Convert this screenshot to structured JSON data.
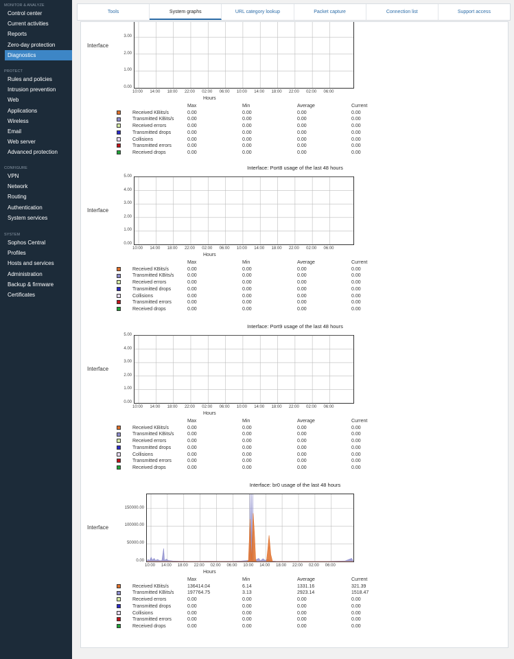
{
  "sidebar": {
    "sections": [
      {
        "title": "MONITOR & ANALYZE",
        "items": [
          {
            "label": "Control center",
            "name": "sidebar-item-control-center"
          },
          {
            "label": "Current activities",
            "name": "sidebar-item-current-activities"
          },
          {
            "label": "Reports",
            "name": "sidebar-item-reports"
          },
          {
            "label": "Zero-day protection",
            "name": "sidebar-item-zero-day-protection"
          },
          {
            "label": "Diagnostics",
            "name": "sidebar-item-diagnostics",
            "active": true
          }
        ]
      },
      {
        "title": "PROTECT",
        "items": [
          {
            "label": "Rules and policies",
            "name": "sidebar-item-rules-and-policies"
          },
          {
            "label": "Intrusion prevention",
            "name": "sidebar-item-intrusion-prevention"
          },
          {
            "label": "Web",
            "name": "sidebar-item-web"
          },
          {
            "label": "Applications",
            "name": "sidebar-item-applications"
          },
          {
            "label": "Wireless",
            "name": "sidebar-item-wireless"
          },
          {
            "label": "Email",
            "name": "sidebar-item-email"
          },
          {
            "label": "Web server",
            "name": "sidebar-item-web-server"
          },
          {
            "label": "Advanced protection",
            "name": "sidebar-item-advanced-protection"
          }
        ]
      },
      {
        "title": "CONFIGURE",
        "items": [
          {
            "label": "VPN",
            "name": "sidebar-item-vpn"
          },
          {
            "label": "Network",
            "name": "sidebar-item-network"
          },
          {
            "label": "Routing",
            "name": "sidebar-item-routing"
          },
          {
            "label": "Authentication",
            "name": "sidebar-item-authentication"
          },
          {
            "label": "System services",
            "name": "sidebar-item-system-services"
          }
        ]
      },
      {
        "title": "SYSTEM",
        "items": [
          {
            "label": "Sophos Central",
            "name": "sidebar-item-sophos-central"
          },
          {
            "label": "Profiles",
            "name": "sidebar-item-profiles"
          },
          {
            "label": "Hosts and services",
            "name": "sidebar-item-hosts-and-services"
          },
          {
            "label": "Administration",
            "name": "sidebar-item-administration"
          },
          {
            "label": "Backup & firmware",
            "name": "sidebar-item-backup-firmware"
          },
          {
            "label": "Certificates",
            "name": "sidebar-item-certificates"
          }
        ]
      }
    ]
  },
  "tabs": [
    {
      "label": "Tools",
      "name": "tab-tools"
    },
    {
      "label": "System graphs",
      "name": "tab-system-graphs",
      "active": true
    },
    {
      "label": "URL category lookup",
      "name": "tab-url-category-lookup"
    },
    {
      "label": "Packet capture",
      "name": "tab-packet-capture"
    },
    {
      "label": "Connection list",
      "name": "tab-connection-list"
    },
    {
      "label": "Support access",
      "name": "tab-support-access"
    }
  ],
  "legend_colors": {
    "received_kbits": "#e0712b",
    "transmitted_kbits": "#8f8fce",
    "received_errors": "#d6eaa6",
    "transmitted_drops": "#2b2bc8",
    "collisions": "#e9dcf2",
    "transmitted_errors": "#c0141a",
    "received_drops": "#22a33a"
  },
  "stats_headers": {
    "max": "Max",
    "min": "Min",
    "average": "Average",
    "current": "Current"
  },
  "chart_data": [
    {
      "type": "line",
      "title": "",
      "side_label": "Interface",
      "xlabel": "Hours",
      "x_ticks": [
        "10:00",
        "14:00",
        "18:00",
        "22:00",
        "02:00",
        "06:00",
        "10:00",
        "14:00",
        "18:00",
        "22:00",
        "02:00",
        "06:00"
      ],
      "y_ticks": [
        "0.00",
        "1.00",
        "2.00",
        "3.00",
        "4.00"
      ],
      "ylim": [
        0,
        5
      ],
      "series": [],
      "stats": [
        {
          "name": "Received KBits/s",
          "color_key": "received_kbits",
          "max": "0.00",
          "min": "0.00",
          "avg": "0.00",
          "cur": "0.00"
        },
        {
          "name": "Transmitted KBits/s",
          "color_key": "transmitted_kbits",
          "max": "0.00",
          "min": "0.00",
          "avg": "0.00",
          "cur": "0.00"
        },
        {
          "name": "Received errors",
          "color_key": "received_errors",
          "max": "0.00",
          "min": "0.00",
          "avg": "0.00",
          "cur": "0.00"
        },
        {
          "name": "Transmitted drops",
          "color_key": "transmitted_drops",
          "max": "0.00",
          "min": "0.00",
          "avg": "0.00",
          "cur": "0.00"
        },
        {
          "name": "Collisions",
          "color_key": "collisions",
          "max": "0.00",
          "min": "0.00",
          "avg": "0.00",
          "cur": "0.00"
        },
        {
          "name": "Transmitted errors",
          "color_key": "transmitted_errors",
          "max": "0.00",
          "min": "0.00",
          "avg": "0.00",
          "cur": "0.00"
        },
        {
          "name": "Received drops",
          "color_key": "received_drops",
          "max": "0.00",
          "min": "0.00",
          "avg": "0.00",
          "cur": "0.00"
        }
      ]
    },
    {
      "type": "line",
      "title": "Interface: Port8 usage of the last 48 hours",
      "side_label": "Interface",
      "xlabel": "Hours",
      "x_ticks": [
        "10:00",
        "14:00",
        "18:00",
        "22:00",
        "02:00",
        "06:00",
        "10:00",
        "14:00",
        "18:00",
        "22:00",
        "02:00",
        "06:00"
      ],
      "y_ticks": [
        "0.00",
        "1.00",
        "2.00",
        "3.00",
        "4.00",
        "5.00"
      ],
      "ylim": [
        0,
        5
      ],
      "series": [],
      "stats": [
        {
          "name": "Received KBits/s",
          "color_key": "received_kbits",
          "max": "0.00",
          "min": "0.00",
          "avg": "0.00",
          "cur": "0.00"
        },
        {
          "name": "Transmitted KBits/s",
          "color_key": "transmitted_kbits",
          "max": "0.00",
          "min": "0.00",
          "avg": "0.00",
          "cur": "0.00"
        },
        {
          "name": "Received errors",
          "color_key": "received_errors",
          "max": "0.00",
          "min": "0.00",
          "avg": "0.00",
          "cur": "0.00"
        },
        {
          "name": "Transmitted drops",
          "color_key": "transmitted_drops",
          "max": "0.00",
          "min": "0.00",
          "avg": "0.00",
          "cur": "0.00"
        },
        {
          "name": "Collisions",
          "color_key": "collisions",
          "max": "0.00",
          "min": "0.00",
          "avg": "0.00",
          "cur": "0.00"
        },
        {
          "name": "Transmitted errors",
          "color_key": "transmitted_errors",
          "max": "0.00",
          "min": "0.00",
          "avg": "0.00",
          "cur": "0.00"
        },
        {
          "name": "Received drops",
          "color_key": "received_drops",
          "max": "0.00",
          "min": "0.00",
          "avg": "0.00",
          "cur": "0.00"
        }
      ]
    },
    {
      "type": "line",
      "title": "Interface: Port9 usage of the last 48 hours",
      "side_label": "Interface",
      "xlabel": "Hours",
      "x_ticks": [
        "10:00",
        "14:00",
        "18:00",
        "22:00",
        "02:00",
        "06:00",
        "10:00",
        "14:00",
        "18:00",
        "22:00",
        "02:00",
        "06:00"
      ],
      "y_ticks": [
        "0.00",
        "1.00",
        "2.00",
        "3.00",
        "4.00",
        "5.00"
      ],
      "ylim": [
        0,
        5
      ],
      "series": [],
      "stats": [
        {
          "name": "Received KBits/s",
          "color_key": "received_kbits",
          "max": "0.00",
          "min": "0.00",
          "avg": "0.00",
          "cur": "0.00"
        },
        {
          "name": "Transmitted KBits/s",
          "color_key": "transmitted_kbits",
          "max": "0.00",
          "min": "0.00",
          "avg": "0.00",
          "cur": "0.00"
        },
        {
          "name": "Received errors",
          "color_key": "received_errors",
          "max": "0.00",
          "min": "0.00",
          "avg": "0.00",
          "cur": "0.00"
        },
        {
          "name": "Transmitted drops",
          "color_key": "transmitted_drops",
          "max": "0.00",
          "min": "0.00",
          "avg": "0.00",
          "cur": "0.00"
        },
        {
          "name": "Collisions",
          "color_key": "collisions",
          "max": "0.00",
          "min": "0.00",
          "avg": "0.00",
          "cur": "0.00"
        },
        {
          "name": "Transmitted errors",
          "color_key": "transmitted_errors",
          "max": "0.00",
          "min": "0.00",
          "avg": "0.00",
          "cur": "0.00"
        },
        {
          "name": "Received drops",
          "color_key": "received_drops",
          "max": "0.00",
          "min": "0.00",
          "avg": "0.00",
          "cur": "0.00"
        }
      ]
    },
    {
      "type": "area",
      "title": "Interface: br0 usage of the last 48 hours",
      "side_label": "Interface",
      "xlabel": "Hours",
      "x_ticks": [
        "10:00",
        "14:00",
        "18:00",
        "22:00",
        "02:00",
        "06:00",
        "10:00",
        "14:00",
        "18:00",
        "22:00",
        "02:00",
        "06:00"
      ],
      "y_ticks": [
        "0.00",
        "50000.00",
        "100000.00",
        "150000.00"
      ],
      "ylim": [
        0,
        190000
      ],
      "xlim_hours": [
        0,
        48
      ],
      "series": [
        {
          "color_key": "transmitted_kbits",
          "points": [
            [
              0,
              0
            ],
            [
              0.3,
              6000
            ],
            [
              0.6,
              2000
            ],
            [
              1,
              12000
            ],
            [
              1.3,
              4000
            ],
            [
              1.7,
              9000
            ],
            [
              2,
              3000
            ],
            [
              2.5,
              6000
            ],
            [
              3,
              2500
            ],
            [
              3.5,
              3000
            ],
            [
              3.9,
              37000
            ],
            [
              4.1,
              2000
            ],
            [
              4.5,
              7000
            ],
            [
              5,
              3000
            ],
            [
              6,
              1500
            ],
            [
              8,
              800
            ],
            [
              10,
              600
            ],
            [
              14,
              900
            ],
            [
              17,
              700
            ],
            [
              20,
              900
            ],
            [
              22,
              1500
            ],
            [
              23.5,
              3000
            ],
            [
              23.9,
              2000
            ],
            [
              24,
              190000
            ],
            [
              24.15,
              0
            ],
            [
              24.3,
              190000
            ],
            [
              24.45,
              2000
            ],
            [
              24.6,
              190000
            ],
            [
              24.75,
              1000
            ],
            [
              25,
              3000
            ],
            [
              26,
              9000
            ],
            [
              26.4,
              2000
            ],
            [
              27,
              8000
            ],
            [
              27.5,
              3000
            ],
            [
              28,
              6000
            ],
            [
              29,
              1500
            ],
            [
              30,
              900
            ],
            [
              34,
              700
            ],
            [
              38,
              600
            ],
            [
              42,
              700
            ],
            [
              46,
              1500
            ],
            [
              47.6,
              9000
            ],
            [
              48,
              0
            ]
          ]
        },
        {
          "color_key": "received_kbits",
          "points": [
            [
              0,
              0
            ],
            [
              22,
              0
            ],
            [
              23.2,
              0
            ],
            [
              23.6,
              2000
            ],
            [
              23.8,
              60000
            ],
            [
              24,
              120000
            ],
            [
              24.3,
              3000
            ],
            [
              24.7,
              136414
            ],
            [
              25,
              80000
            ],
            [
              25.3,
              3000
            ],
            [
              25.5,
              0
            ],
            [
              27.8,
              0
            ],
            [
              28.1,
              35000
            ],
            [
              28.4,
              74000
            ],
            [
              28.8,
              20000
            ],
            [
              29.2,
              0
            ],
            [
              48,
              0
            ]
          ]
        }
      ],
      "stats": [
        {
          "name": "Received KBits/s",
          "color_key": "received_kbits",
          "max": "136414.04",
          "min": "6.14",
          "avg": "1331.16",
          "cur": "321.39"
        },
        {
          "name": "Transmitted KBits/s",
          "color_key": "transmitted_kbits",
          "max": "197764.75",
          "min": "3.13",
          "avg": "2923.14",
          "cur": "1518.47"
        },
        {
          "name": "Received errors",
          "color_key": "received_errors",
          "max": "0.00",
          "min": "0.00",
          "avg": "0.00",
          "cur": "0.00"
        },
        {
          "name": "Transmitted drops",
          "color_key": "transmitted_drops",
          "max": "0.00",
          "min": "0.00",
          "avg": "0.00",
          "cur": "0.00"
        },
        {
          "name": "Collisions",
          "color_key": "collisions",
          "max": "0.00",
          "min": "0.00",
          "avg": "0.00",
          "cur": "0.00"
        },
        {
          "name": "Transmitted errors",
          "color_key": "transmitted_errors",
          "max": "0.00",
          "min": "0.00",
          "avg": "0.00",
          "cur": "0.00"
        },
        {
          "name": "Received drops",
          "color_key": "received_drops",
          "max": "0.00",
          "min": "0.00",
          "avg": "0.00",
          "cur": "0.00"
        }
      ]
    }
  ]
}
